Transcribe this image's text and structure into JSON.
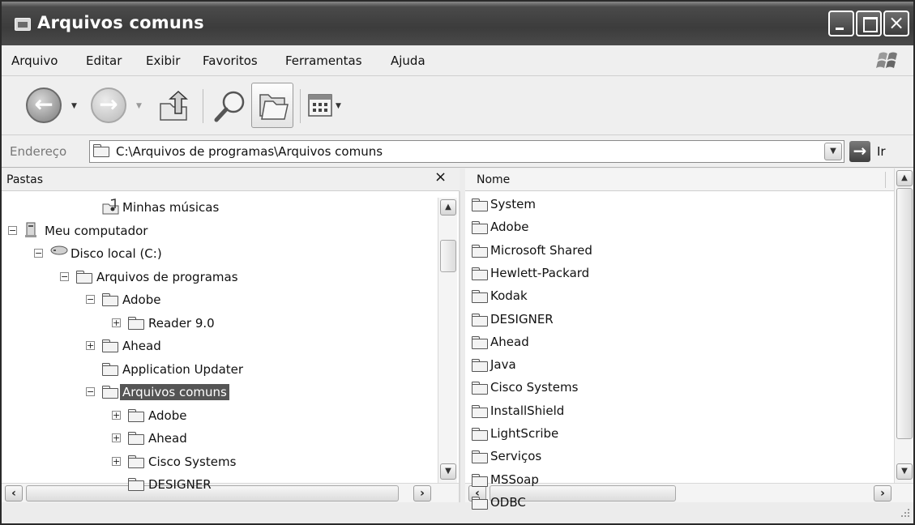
{
  "window": {
    "title": "Arquivos comuns"
  },
  "menu": [
    "Arquivo",
    "Editar",
    "Exibir",
    "Favoritos",
    "Ferramentas",
    "Ajuda"
  ],
  "toolbar": {
    "back": "back-icon",
    "forward": "forward-icon",
    "up": "up-folder-icon",
    "search": "search-icon",
    "folders": "folders-icon",
    "views": "views-icon"
  },
  "address": {
    "label": "Endereço",
    "path": "C:\\Arquivos de programas\\Arquivos comuns",
    "go_label": "Ir"
  },
  "left_pane": {
    "header": "Pastas",
    "close_label": "×",
    "tree": [
      {
        "label": "Minhas músicas",
        "indent": 3,
        "expander": "",
        "icon": "music-folder-icon"
      },
      {
        "label": "Meu computador",
        "indent": 0,
        "expander": "−",
        "icon": "computer-icon"
      },
      {
        "label": "Disco local (C:)",
        "indent": 1,
        "expander": "−",
        "icon": "drive-icon"
      },
      {
        "label": "Arquivos de programas",
        "indent": 2,
        "expander": "−",
        "icon": "folder-icon"
      },
      {
        "label": "Adobe",
        "indent": 3,
        "expander": "−",
        "icon": "folder-icon"
      },
      {
        "label": "Reader 9.0",
        "indent": 4,
        "expander": "+",
        "icon": "folder-icon"
      },
      {
        "label": "Ahead",
        "indent": 3,
        "expander": "+",
        "icon": "folder-icon"
      },
      {
        "label": "Application Updater",
        "indent": 3,
        "expander": "",
        "icon": "folder-icon"
      },
      {
        "label": "Arquivos comuns",
        "indent": 3,
        "expander": "−",
        "icon": "open-folder-icon",
        "selected": true
      },
      {
        "label": "Adobe",
        "indent": 4,
        "expander": "+",
        "icon": "folder-icon"
      },
      {
        "label": "Ahead",
        "indent": 4,
        "expander": "+",
        "icon": "folder-icon"
      },
      {
        "label": "Cisco Systems",
        "indent": 4,
        "expander": "+",
        "icon": "folder-icon"
      },
      {
        "label": "DESIGNER",
        "indent": 4,
        "expander": "",
        "icon": "folder-icon"
      }
    ]
  },
  "right_pane": {
    "column": "Nome",
    "items": [
      "System",
      "Adobe",
      "Microsoft Shared",
      "Hewlett-Packard",
      "Kodak",
      "DESIGNER",
      "Ahead",
      "Java",
      "Cisco Systems",
      "InstallShield",
      "LightScribe",
      "Serviços",
      "MSSoap",
      "ODBC"
    ]
  },
  "colors": {
    "titlebar": "#3c3c3c",
    "selection": "#555555"
  }
}
